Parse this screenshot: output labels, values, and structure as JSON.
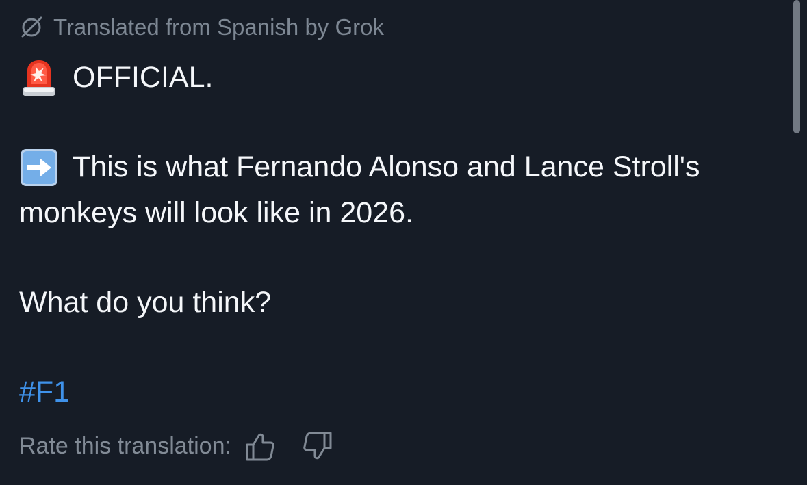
{
  "translation_notice": {
    "icon": "grok-slash-icon",
    "text": "Translated from Spanish by Grok"
  },
  "post": {
    "line1": "OFFICIAL.",
    "line2": "This is what Fernando Alonso and Lance Stroll's",
    "line3": "monkeys will look like in 2026.",
    "line4": "What do you think?",
    "hashtag": "#F1"
  },
  "emoji": {
    "siren": "police-car-light-emoji",
    "arrow": "right-arrow-emoji"
  },
  "rating": {
    "label": "Rate this translation:",
    "thumbs_up_icon": "thumbs-up-icon",
    "thumbs_down_icon": "thumbs-down-icon"
  },
  "colors": {
    "background": "#161c26",
    "text": "#f5f7fa",
    "muted": "#7d8793",
    "hashtag": "#3f92ea",
    "scrollbar": "#727983"
  }
}
